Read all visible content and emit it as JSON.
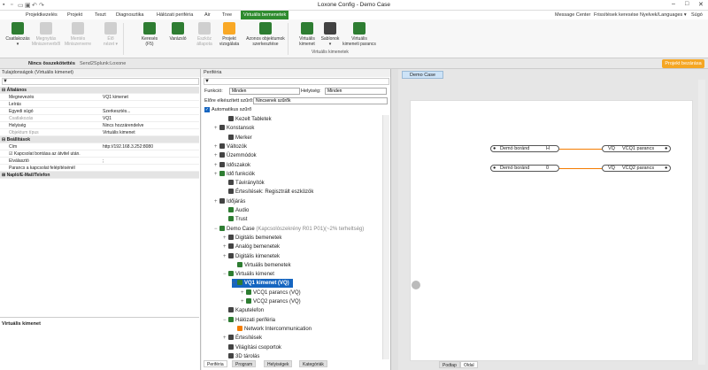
{
  "window": {
    "title": "Loxone Config - Demo Case",
    "menu_items": [
      "Message Center",
      "Frissítések keresése",
      "Nyelvek/Languages ▾",
      "Súgó"
    ],
    "tabs": [
      "Projektkezelés",
      "Projekt",
      "Teszt",
      "Diagnosztika",
      "Hálózati periféria",
      "Air",
      "Tree",
      "Virtuális bemenetek"
    ]
  },
  "ribbon": {
    "buttons": [
      {
        "label": "Csatlakozás",
        "sub": "▾",
        "color": "#2e7d32",
        "disabled": false
      },
      {
        "label": "Megnyitás",
        "sub": "Miniszerverből",
        "color": "#9e9e9e",
        "disabled": true
      },
      {
        "label": "Mentés",
        "sub": "Miniszerverre",
        "color": "#9e9e9e",
        "disabled": true
      },
      {
        "label": "Élő",
        "sub": "nézet ▾",
        "color": "#9e9e9e",
        "disabled": true
      },
      {
        "label": "Keresés",
        "sub": "(F5)",
        "color": "#2e7d32",
        "disabled": false
      },
      {
        "label": "Varázsló",
        "sub": "",
        "color": "#2e7d32",
        "disabled": false
      },
      {
        "label": "Eszköz",
        "sub": "állapota",
        "color": "#9e9e9e",
        "disabled": true
      },
      {
        "label": "Projekt",
        "sub": "vizsgálata",
        "color": "#f9a825",
        "disabled": false
      },
      {
        "label": "Azonos objektumok",
        "sub": "szerkesztése",
        "color": "#2e7d32",
        "disabled": false
      },
      {
        "label": "Virtuális",
        "sub": "kimenet",
        "color": "#2e7d32",
        "disabled": false
      },
      {
        "label": "Sablonok",
        "sub": "▾",
        "color": "#424242",
        "disabled": false
      },
      {
        "label": "Virtuális",
        "sub": "kimeneti parancs",
        "color": "#2e7d32",
        "disabled": false
      }
    ],
    "group_label": "Virtuális kimenetek"
  },
  "strip": {
    "status": "Nincs összekötettés",
    "link": "Send2Splunk:Loxone",
    "button": "Projekt bezárása",
    "button_color": "#f5a623"
  },
  "left": {
    "header": "Tulajdonságok (Virtuális kimenet)",
    "sections": [
      {
        "name": "Általános",
        "rows": [
          [
            "Megnevezés",
            "VQ1 kimenet"
          ],
          [
            "Leírás",
            ""
          ],
          [
            "Egyedi súgó",
            "Szerkesztés..."
          ],
          [
            "Csatlakozás",
            "VQ1"
          ],
          [
            "Helyiség",
            "Nincs hozzárendelve"
          ],
          [
            "Objektum típus",
            "Virtuális kimenet"
          ]
        ]
      },
      {
        "name": "Beállítások",
        "rows": [
          [
            "Cím",
            "http://192.168.3.252:8080"
          ],
          [
            "Kapcsolat bontása az átvitel után.",
            ""
          ],
          [
            "Elválasztó",
            ";"
          ],
          [
            "Parancs a kapcsolat felépítésénél",
            ""
          ]
        ]
      },
      {
        "name": "Napló/E-Mail/Telefon",
        "rows": []
      }
    ],
    "bottom_label": "Virtuális kimenet"
  },
  "mid": {
    "header": "Periféria",
    "funkcio_label": "Funkció:",
    "funkcio_value": "Minden",
    "helyiseg_label": "Helyiség:",
    "helyiseg_value": "Minden",
    "filter_label": "Előre elkészített szűrő:",
    "filter_value": "Nincsenek szűrők",
    "auto_filter": "Automatikus szűrő",
    "tree": [
      {
        "d": 1,
        "t": "Kezelt Tabletek",
        "c": "#444"
      },
      {
        "d": 0,
        "t": "Konstansok",
        "c": "#444",
        "e": "+"
      },
      {
        "d": 1,
        "t": "Merker",
        "c": "#444"
      },
      {
        "d": 0,
        "t": "Változók",
        "c": "#444",
        "e": "+"
      },
      {
        "d": 0,
        "t": "Üzemmódok",
        "c": "#444",
        "e": "+"
      },
      {
        "d": 0,
        "t": "Időszakok",
        "c": "#444",
        "e": "+"
      },
      {
        "d": 0,
        "t": "Idő funkciók",
        "c": "#2e7d32",
        "e": "+"
      },
      {
        "d": 1,
        "t": "Távirányítók",
        "c": "#444"
      },
      {
        "d": 1,
        "t": "Értesítések: Regisztrált eszközök",
        "c": "#444"
      },
      {
        "d": 0,
        "t": "Időjárás",
        "c": "#444",
        "e": "+"
      },
      {
        "d": 1,
        "t": "Audio",
        "c": "#2e7d32"
      },
      {
        "d": 1,
        "t": "Trust",
        "c": "#2e7d32"
      },
      {
        "d": 0,
        "t": "Demo Case (Kapcsolószekrény R01 P01)(~2% terheltség)",
        "c": "#2e7d32",
        "e": "−",
        "gray": " (Kapcsolószekrény R01 P01)(~2% terheltség)",
        "main": "Demo Case"
      },
      {
        "d": 1,
        "t": "Digitális bemenetek",
        "c": "#444",
        "e": "+"
      },
      {
        "d": 1,
        "t": "Analóg bemenetek",
        "c": "#444",
        "e": "+"
      },
      {
        "d": 1,
        "t": "Digitális kimenetek",
        "c": "#444",
        "e": "+"
      },
      {
        "d": 2,
        "t": "Virtuális bemenetek",
        "c": "#2e7d32"
      },
      {
        "d": 1,
        "t": "Virtuális kimenet",
        "c": "#2e7d32",
        "e": "−"
      },
      {
        "d": 2,
        "t": "VQ1 kimenet (VQ)",
        "c": "#2e7d32",
        "e": "−",
        "sel": true
      },
      {
        "d": 3,
        "t": "VCQ1 parancs (VQ)",
        "c": "#2e7d32",
        "e": "+"
      },
      {
        "d": 3,
        "t": "VCQ2 parancs (VQ)",
        "c": "#2e7d32",
        "e": "+"
      },
      {
        "d": 1,
        "t": "Kaputelefon",
        "c": "#444"
      },
      {
        "d": 1,
        "t": "Hálózati periféria",
        "c": "#2e7d32",
        "e": "−"
      },
      {
        "d": 2,
        "t": "Network Intercommunication",
        "c": "#f57c00"
      },
      {
        "d": 1,
        "t": "Értesítések",
        "c": "#444",
        "e": "+"
      },
      {
        "d": 1,
        "t": "Világítási csoportok",
        "c": "#444"
      },
      {
        "d": 1,
        "t": "3D tárolás",
        "c": "#444"
      }
    ],
    "bottom_tabs": [
      "Periféria",
      "Program",
      "Helyiségek",
      "Kategóriák"
    ]
  },
  "right": {
    "tab": "Demo Case",
    "bottom_tabs": [
      "Podtap",
      "Oldal"
    ],
    "blocks": [
      {
        "left": "Demó boránd",
        "mid": "H",
        "r1": "VQ",
        "r2": "VCQ1 parancs"
      },
      {
        "left": "Demó boránd",
        "mid": "0",
        "r1": "VQ",
        "r2": "VCQ2 parancs"
      }
    ]
  }
}
